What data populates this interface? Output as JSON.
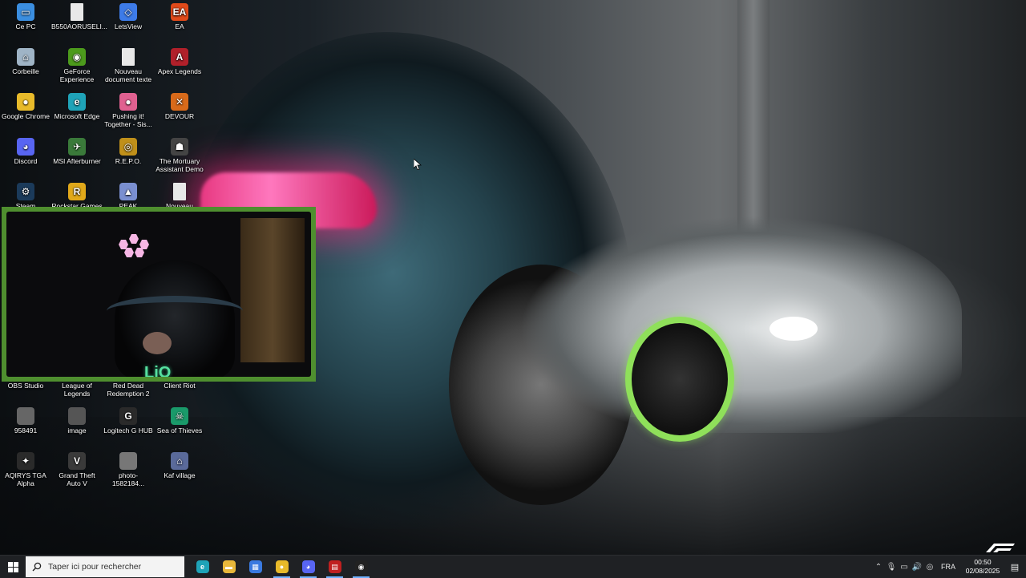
{
  "desktop": {
    "icons": [
      {
        "id": "ce-pc",
        "label": "Ce PC",
        "icon": "computer-icon",
        "color": "#3b8ee0",
        "glyph": "▭"
      },
      {
        "id": "b550",
        "label": "B550AORUSELI...",
        "icon": "document-icon",
        "color": "#e8e8e8",
        "glyph": ""
      },
      {
        "id": "letsview",
        "label": "LetsView",
        "icon": "letsview-icon",
        "color": "#3d7be8",
        "glyph": "◇"
      },
      {
        "id": "ea",
        "label": "EA",
        "icon": "ea-icon",
        "color": "#e04a1a",
        "glyph": "EA"
      },
      {
        "id": "corbeille",
        "label": "Corbeille",
        "icon": "recycle-bin-icon",
        "color": "#9fb4c6",
        "glyph": "⌂"
      },
      {
        "id": "geforce",
        "label": "GeForce Experience",
        "icon": "geforce-icon",
        "color": "#4c9a1c",
        "glyph": "◉"
      },
      {
        "id": "nouveau1",
        "label": "Nouveau document texte",
        "icon": "text-document-icon",
        "color": "#e8e8e8",
        "glyph": ""
      },
      {
        "id": "apex",
        "label": "Apex Legends",
        "icon": "apex-icon",
        "color": "#b0202a",
        "glyph": "A"
      },
      {
        "id": "chrome",
        "label": "Google Chrome",
        "icon": "chrome-icon",
        "color": "#e8ba2a",
        "glyph": "●"
      },
      {
        "id": "edge",
        "label": "Microsoft Edge",
        "icon": "edge-icon",
        "color": "#1fa3b8",
        "glyph": "e"
      },
      {
        "id": "pushing",
        "label": "Pushing it! Together - Sis...",
        "icon": "pushing-it-icon",
        "color": "#e06090",
        "glyph": "●"
      },
      {
        "id": "devour",
        "label": "DEVOUR",
        "icon": "devour-icon",
        "color": "#d86a1a",
        "glyph": "✕"
      },
      {
        "id": "discord",
        "label": "Discord",
        "icon": "discord-icon",
        "color": "#5865f2",
        "glyph": "◕"
      },
      {
        "id": "afterburner",
        "label": "MSI Afterburner",
        "icon": "afterburner-icon",
        "color": "#3a7a3a",
        "glyph": "✈"
      },
      {
        "id": "repo",
        "label": "R.E.P.O.",
        "icon": "repo-icon",
        "color": "#c0901a",
        "glyph": "◎"
      },
      {
        "id": "mortuary",
        "label": "The Mortuary Assistant Demo",
        "icon": "mortuary-icon",
        "color": "#444",
        "glyph": "☗"
      },
      {
        "id": "steam",
        "label": "Steam",
        "icon": "steam-icon",
        "color": "#1b3a5a",
        "glyph": "⚙"
      },
      {
        "id": "rockstar",
        "label": "Rockstar Games",
        "icon": "rockstar-icon",
        "color": "#e0a81a",
        "glyph": "R"
      },
      {
        "id": "peak",
        "label": "PEAK",
        "icon": "peak-icon",
        "color": "#7a8fd0",
        "glyph": "▲"
      },
      {
        "id": "nouveau2",
        "label": "Nouveau",
        "icon": "text-document-icon",
        "color": "#e8e8e8",
        "glyph": ""
      },
      {
        "id": "obs",
        "label": "OBS Studio",
        "icon": "obs-icon",
        "color": "#222",
        "glyph": "●"
      },
      {
        "id": "lol",
        "label": "League of Legends",
        "icon": "lol-icon",
        "color": "#b08a2a",
        "glyph": "L"
      },
      {
        "id": "rdr2",
        "label": "Red Dead Redemption 2",
        "icon": "rdr2-icon",
        "color": "#9a1a1a",
        "glyph": "R"
      },
      {
        "id": "riot",
        "label": "Client Riot",
        "icon": "riot-icon",
        "color": "#d82030",
        "glyph": "✊"
      },
      {
        "id": "p958491",
        "label": "958491",
        "icon": "image-icon",
        "color": "#666",
        "glyph": ""
      },
      {
        "id": "image",
        "label": "image",
        "icon": "image-icon",
        "color": "#555",
        "glyph": ""
      },
      {
        "id": "ghub",
        "label": "Logitech G HUB",
        "icon": "ghub-icon",
        "color": "#2a2a2a",
        "glyph": "G"
      },
      {
        "id": "sot",
        "label": "Sea of Thieves",
        "icon": "sea-of-thieves-icon",
        "color": "#1a9a6a",
        "glyph": "☠"
      },
      {
        "id": "aqirys",
        "label": "AQIRYS TGA Alpha",
        "icon": "aqirys-icon",
        "color": "#2a2a2a",
        "glyph": "✦"
      },
      {
        "id": "gta",
        "label": "Grand Theft Auto V",
        "icon": "gta-icon",
        "color": "#3a3a3a",
        "glyph": "V"
      },
      {
        "id": "photo",
        "label": "photo-1582184...",
        "icon": "image-icon",
        "color": "#777",
        "glyph": ""
      },
      {
        "id": "kaf",
        "label": "Kaf village",
        "icon": "kaf-village-icon",
        "color": "#5a6a9a",
        "glyph": "⌂"
      }
    ]
  },
  "webcam": {
    "logo_text": "LiO"
  },
  "taskbar": {
    "search_placeholder": "Taper ici pour rechercher",
    "apps": [
      {
        "name": "edge",
        "icon": "edge-icon",
        "color": "#1fa3b8",
        "glyph": "e",
        "running": false
      },
      {
        "name": "file-explorer",
        "icon": "folder-icon",
        "color": "#e8b83a",
        "glyph": "▬",
        "running": false
      },
      {
        "name": "store",
        "icon": "store-icon",
        "color": "#3a7ae0",
        "glyph": "▦",
        "running": false
      },
      {
        "name": "chrome",
        "icon": "chrome-icon",
        "color": "#e8ba2a",
        "glyph": "●",
        "running": true
      },
      {
        "name": "discord",
        "icon": "discord-icon",
        "color": "#5865f2",
        "glyph": "◕",
        "running": true
      },
      {
        "name": "voicemeeter",
        "icon": "voicemeeter-icon",
        "color": "#c02020",
        "glyph": "▤",
        "running": true
      },
      {
        "name": "obs",
        "icon": "obs-icon",
        "color": "#222",
        "glyph": "◉",
        "running": true
      }
    ],
    "tray": {
      "language": "FRA",
      "time": "00:50",
      "date": "02/08/2025"
    }
  }
}
